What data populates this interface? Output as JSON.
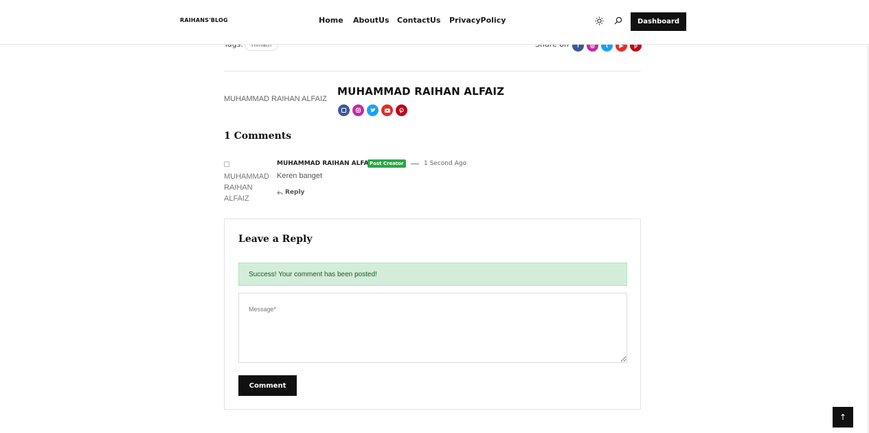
{
  "header": {
    "logo": "RAIHANS'BLOG",
    "nav": [
      "Home",
      "AboutUs",
      "ContactUs",
      "PrivacyPolicy"
    ],
    "dashboard_label": "Dashboard",
    "icons": [
      "sun-icon",
      "search-icon"
    ]
  },
  "post_meta": {
    "tags_label": "Tags:",
    "tags": [
      "Himath"
    ],
    "share_label": "Share on :",
    "share_icons": [
      "facebook-icon",
      "instagram-icon",
      "twitter-icon",
      "youtube-icon",
      "pinterest-icon"
    ]
  },
  "author": {
    "image_alt": "MUHAMMAD RAIHAN ALFAIZ",
    "name": "MUHAMMAD RAIHAN ALFAIZ",
    "social_icons": [
      "facebook-icon",
      "instagram-icon",
      "twitter-icon",
      "youtube-icon",
      "pinterest-icon"
    ]
  },
  "social_colors": {
    "facebook": "#3b5998",
    "instagram": "#c32aa3",
    "twitter": "#1da1f2",
    "youtube": "#e52d27",
    "pinterest": "#bd081c"
  },
  "comments": {
    "title": "1 Comments",
    "items": [
      {
        "avatar_alt": "MUHAMMAD RAIHAN ALFAIZ",
        "author": "MUHAMMAD RAIHAN ALFAIZ",
        "badge": "Post Creator",
        "time": "1 Second Ago",
        "text": "Keren banget",
        "reply_label": "Reply"
      }
    ]
  },
  "reply_form": {
    "title": "Leave a Reply",
    "success_message": "Success! Your comment has been posted!",
    "message_placeholder": "Message*",
    "message_value": "",
    "submit_label": "Comment"
  },
  "back_to_top": "↑"
}
